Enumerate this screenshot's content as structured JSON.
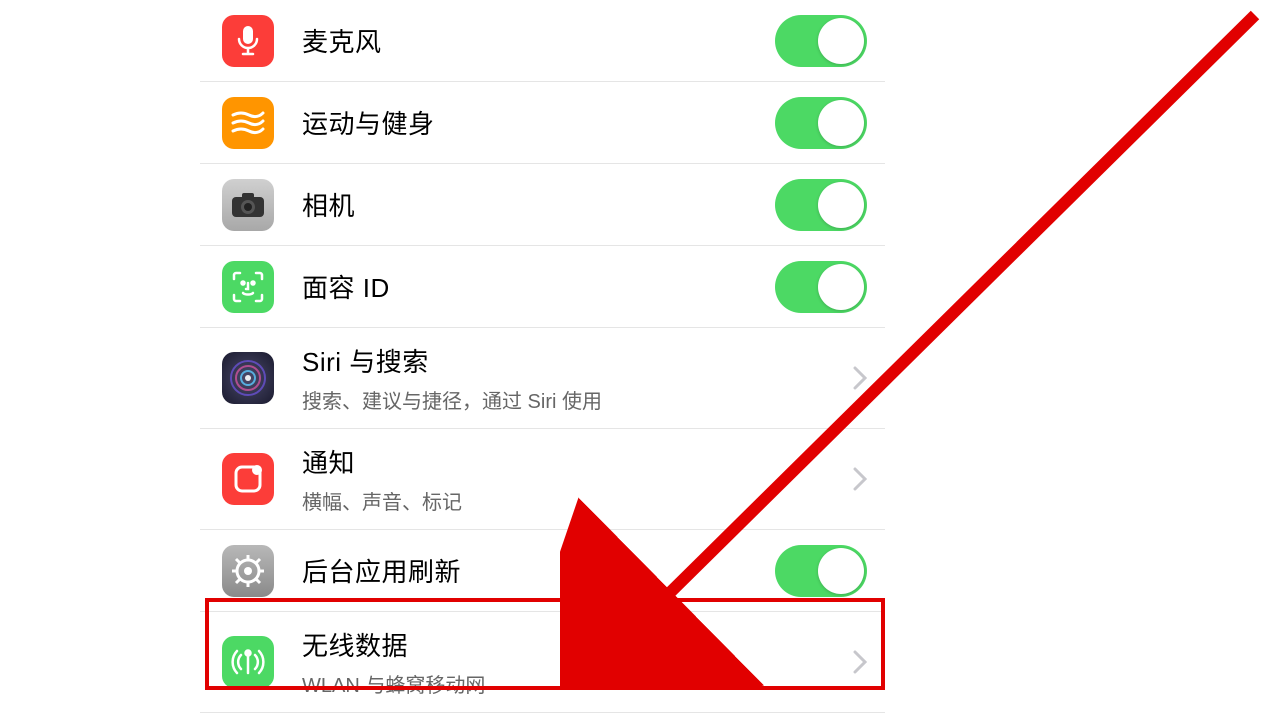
{
  "rows": {
    "microphone": {
      "label": "麦克风",
      "toggle": true
    },
    "fitness": {
      "label": "运动与健身",
      "toggle": true
    },
    "camera": {
      "label": "相机",
      "toggle": true
    },
    "faceid": {
      "label": "面容 ID",
      "toggle": true
    },
    "siri": {
      "label": "Siri 与搜索",
      "sublabel": "搜索、建议与捷径，通过 Siri 使用"
    },
    "notif": {
      "label": "通知",
      "sublabel": "横幅、声音、标记"
    },
    "bgrefresh": {
      "label": "后台应用刷新",
      "toggle": true
    },
    "wireless": {
      "label": "无线数据",
      "sublabel": "WLAN 与蜂窝移动网"
    }
  },
  "icons": {
    "microphone": "microphone-icon",
    "fitness": "fitness-icon",
    "camera": "camera-icon",
    "faceid": "faceid-icon",
    "siri": "siri-icon",
    "notif": "notifications-icon",
    "bgrefresh": "gear-icon",
    "wireless": "wireless-icon"
  },
  "colors": {
    "toggle_on": "#4cd964",
    "highlight": "#e10000"
  }
}
